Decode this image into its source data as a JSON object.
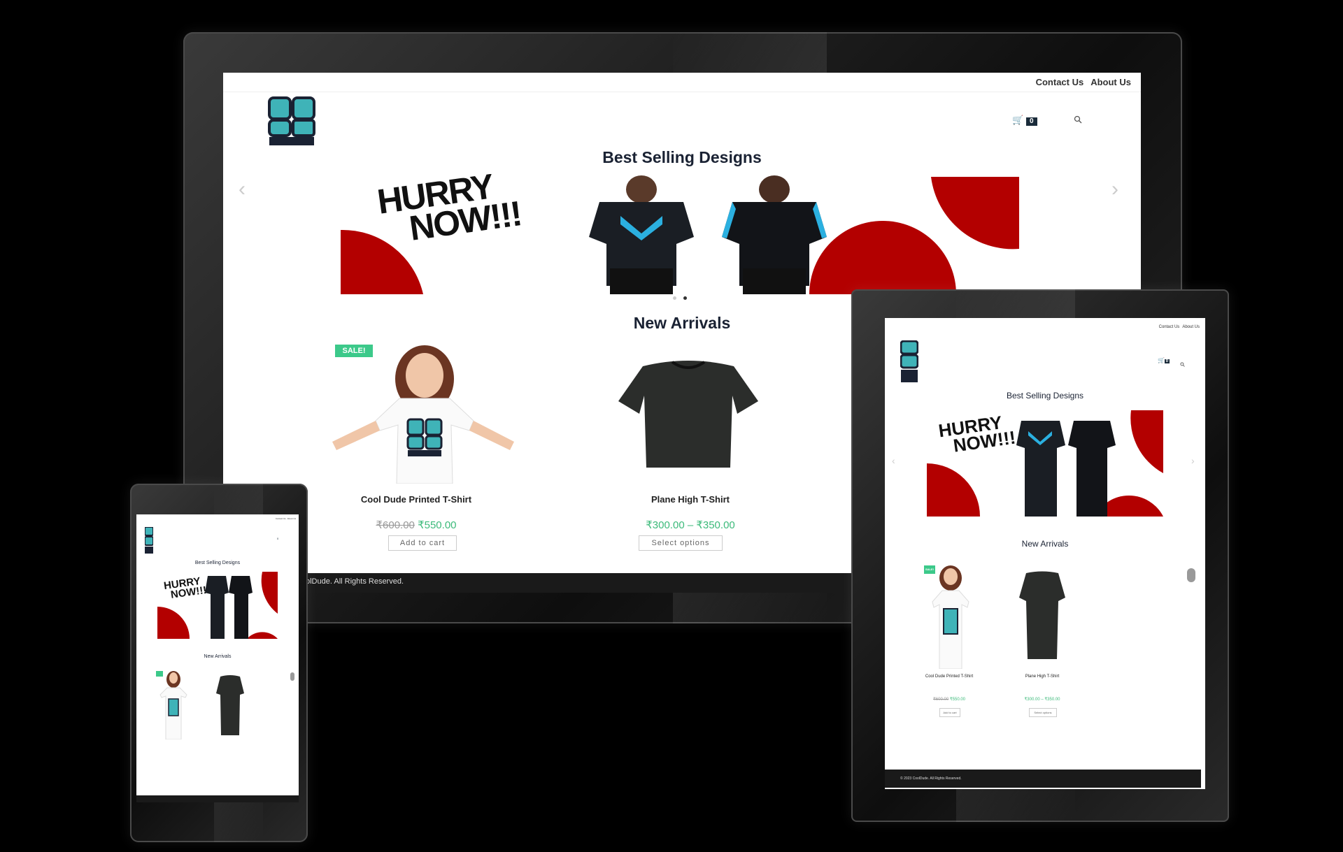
{
  "nav": {
    "contact": "Contact Us",
    "about": "About Us"
  },
  "cart": {
    "count": "0"
  },
  "logo": {
    "line1": "CO",
    "line2": "OL",
    "line3": "DUDE"
  },
  "hero": {
    "title": "Best Selling Designs",
    "banner_text_1": "HURRY",
    "banner_text_2": "NOW!!!",
    "prev": "‹",
    "next": "›"
  },
  "arrivals": {
    "title": "New Arrivals",
    "products": [
      {
        "name": "Cool Dude Printed T-Shirt",
        "old_price": "₹600.00",
        "price": "₹550.00",
        "button": "Add to cart",
        "badge": "SALE!"
      },
      {
        "name": "Plane High T-Shirt",
        "price_range": "₹300.00 – ₹350.00",
        "button": "Select options"
      }
    ]
  },
  "footer": {
    "desktop_text": "olDude. All Rights Reserved.",
    "tablet_text": "© 2023 CoolDude. All Rights Reserved."
  },
  "colors": {
    "accent_red": "#b30000",
    "teal": "#3fb3b8",
    "navy": "#1a2233",
    "sale_green": "#3cc98a",
    "price_green": "#3cba7a"
  }
}
